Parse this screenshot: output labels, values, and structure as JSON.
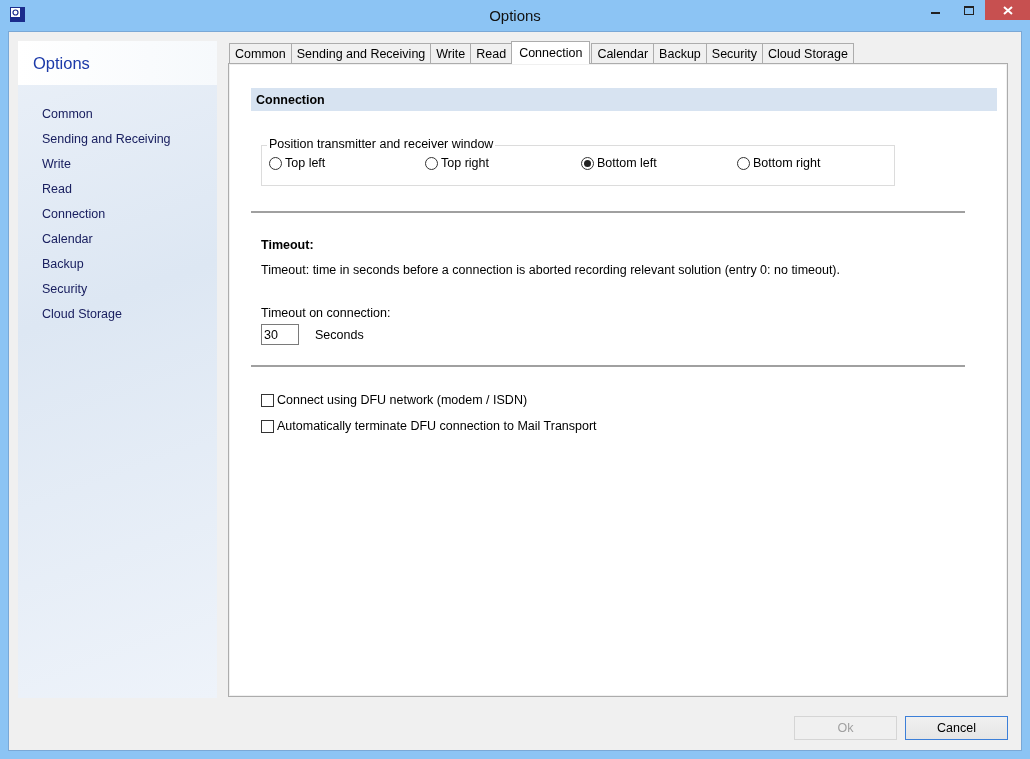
{
  "window": {
    "title": "Options"
  },
  "sidebar": {
    "title": "Options",
    "items": [
      {
        "label": "Common"
      },
      {
        "label": "Sending and Receiving"
      },
      {
        "label": "Write"
      },
      {
        "label": "Read"
      },
      {
        "label": "Connection"
      },
      {
        "label": "Calendar"
      },
      {
        "label": "Backup"
      },
      {
        "label": "Security"
      },
      {
        "label": "Cloud Storage"
      }
    ]
  },
  "tabs": [
    {
      "label": "Common",
      "selected": false
    },
    {
      "label": "Sending and Receiving",
      "selected": false
    },
    {
      "label": "Write",
      "selected": false
    },
    {
      "label": "Read",
      "selected": false
    },
    {
      "label": "Connection",
      "selected": true
    },
    {
      "label": "Calendar",
      "selected": false
    },
    {
      "label": "Backup",
      "selected": false
    },
    {
      "label": "Security",
      "selected": false
    },
    {
      "label": "Cloud Storage",
      "selected": false
    }
  ],
  "section": {
    "title": "Connection",
    "position_group": {
      "legend": "Position transmitter and receiver window",
      "options": [
        {
          "label": "Top left",
          "selected": false
        },
        {
          "label": "Top right",
          "selected": false
        },
        {
          "label": "Bottom left",
          "selected": true
        },
        {
          "label": "Bottom right",
          "selected": false
        }
      ]
    },
    "timeout": {
      "heading": "Timeout:",
      "description": "Timeout: time in seconds before a connection is aborted recording relevant solution (entry 0: no timeout).",
      "field_label": "Timeout on connection:",
      "value": "30",
      "unit": "Seconds"
    },
    "checkboxes": [
      {
        "label": "Connect using DFU network (modem / ISDN)",
        "checked": false
      },
      {
        "label": "Automatically terminate DFU connection to Mail Transport",
        "checked": false
      }
    ]
  },
  "buttons": [
    {
      "label": "Ok",
      "disabled": true
    },
    {
      "label": "Cancel",
      "disabled": false
    }
  ]
}
